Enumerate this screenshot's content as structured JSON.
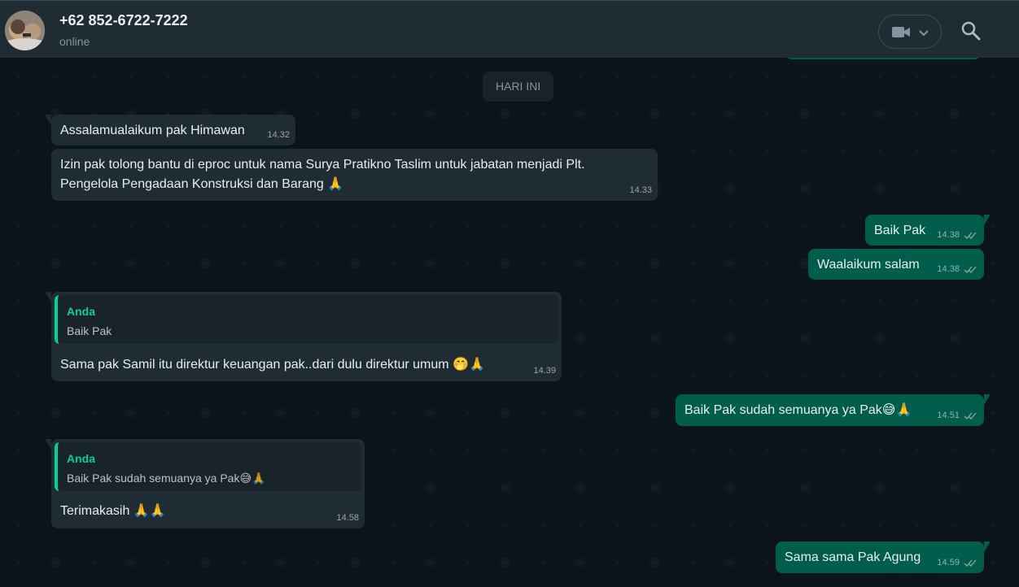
{
  "header": {
    "contact_name": "+62 852-6722-7222",
    "status": "online"
  },
  "chat": {
    "date_divider": "HARI INI",
    "messages": [
      {
        "direction": "in",
        "text": "Assalamualaikum pak Himawan",
        "time": "14.32"
      },
      {
        "direction": "in",
        "line1": "Izin pak tolong bantu di eproc untuk nama Surya Pratikno Taslim untuk jabatan menjadi Plt.",
        "line2": "Pengelola Pengadaan Konstruksi dan Barang 🙏",
        "time": "14.33"
      },
      {
        "direction": "out",
        "text": "Baik Pak",
        "time": "14.38",
        "status": "read"
      },
      {
        "direction": "out",
        "text": "Waalaikum salam",
        "time": "14.38",
        "status": "read"
      },
      {
        "direction": "in",
        "quote_author": "Anda",
        "quote_text": "Baik Pak",
        "text": "Sama pak Samil itu direktur keuangan pak..dari dulu direktur umum 🤭🙏",
        "time": "14.39"
      },
      {
        "direction": "out",
        "text": "Baik Pak sudah semuanya ya Pak😅🙏",
        "time": "14.51",
        "status": "read"
      },
      {
        "direction": "in",
        "quote_author": "Anda",
        "quote_text": "Baik Pak sudah semuanya ya Pak😅🙏",
        "text": "Terimakasih 🙏🙏",
        "time": "14.58"
      },
      {
        "direction": "out",
        "text": "Sama sama Pak Agung",
        "time": "14.59",
        "status": "read"
      }
    ]
  },
  "icons": {
    "video": "video-camera-icon",
    "dropdown": "chevron-down-icon",
    "search": "search-icon",
    "read_receipt": "double-check-icon"
  },
  "colors": {
    "header_bg": "#202c33",
    "chat_bg": "#0b141a",
    "incoming_bubble": "#202c33",
    "outgoing_bubble": "#005c4b",
    "quote_accent": "#06cf9c"
  }
}
